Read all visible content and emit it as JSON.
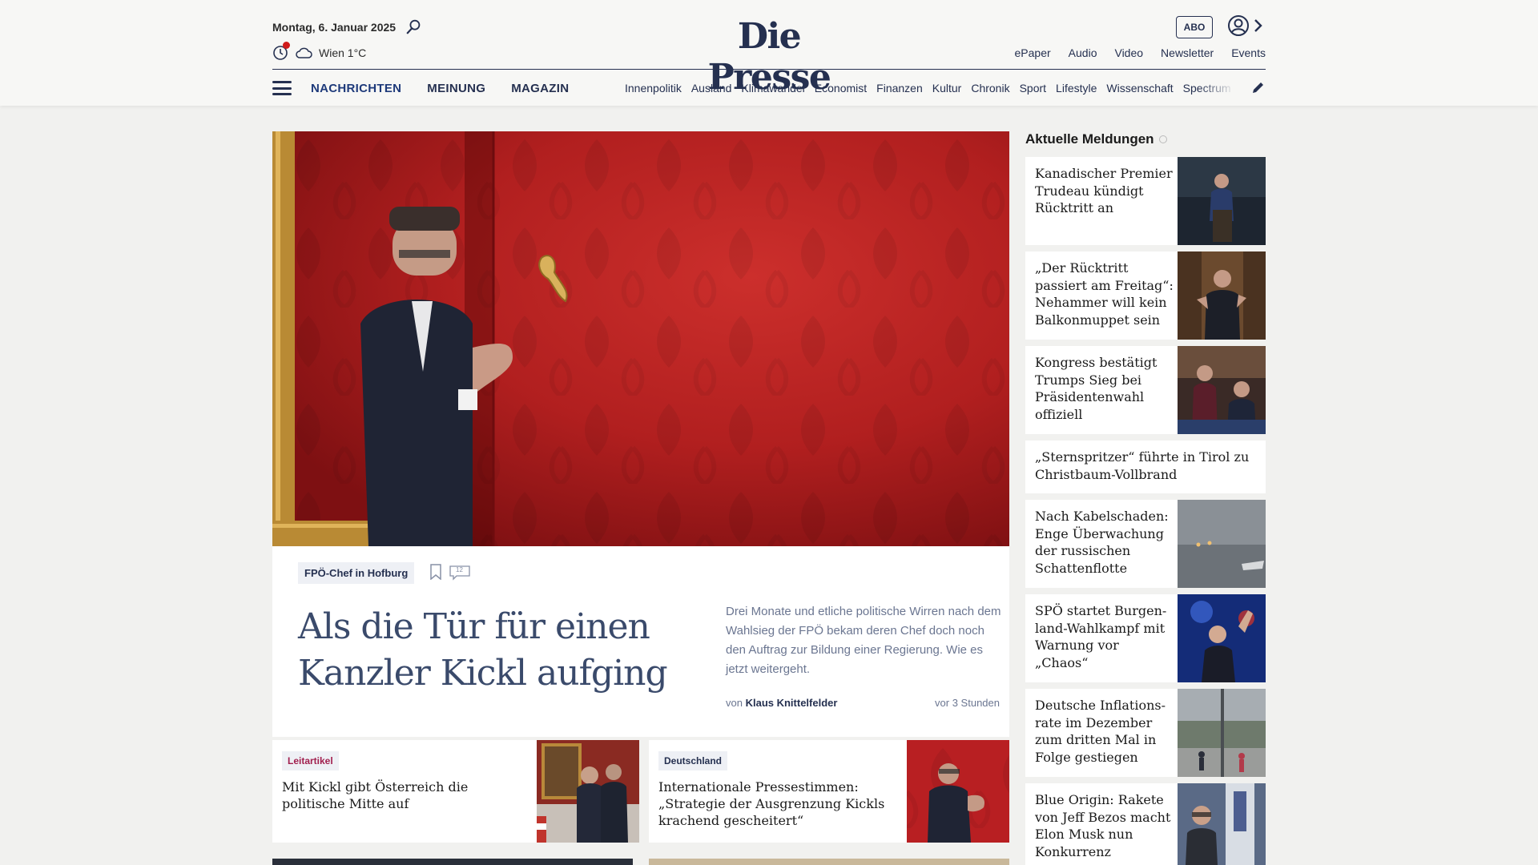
{
  "header": {
    "date": "Montag, 6. Januar 2025",
    "weather": "Wien 1°C",
    "logo": "Die Presse",
    "abo_label": "ABO",
    "top_links": [
      "ePaper",
      "Audio",
      "Video",
      "Newsletter",
      "Events"
    ]
  },
  "nav": {
    "main": [
      "NACHRICHTEN",
      "MEINUNG",
      "MAGAZIN"
    ],
    "sub": [
      "Innenpolitik",
      "Ausland",
      "Klimawandel",
      "Economist",
      "Finanzen",
      "Kultur",
      "Chronik",
      "Sport",
      "Lifestyle",
      "Wissenschaft",
      "Spectrum"
    ]
  },
  "hero": {
    "tag": "FPÖ-Chef in Hofburg",
    "comments": "12",
    "title": "Als die Tür für einen Kanzler Kickl aufging",
    "lead": "Drei Monate und etliche politische Wirren nach dem Wahlsieg der FPÖ bekam deren Chef doch noch den Auftrag zur Bildung einer Regierung. Wie es jetzt weitergeht.",
    "byline_prefix": "von",
    "author": "Klaus Knittelfelder",
    "time": "vor 3 Stunden"
  },
  "cards": [
    {
      "tag": "Leitartikel",
      "tag_color": "#a11f4e",
      "title": "Mit Kickl gibt Österreich die politische Mitte auf"
    },
    {
      "tag": "Deutschland",
      "tag_color": "#253050",
      "title": "Internationale Pressestimmen: „Strategie der Ausgrenzung Kickls krachend gescheitert“"
    }
  ],
  "sidebar": {
    "heading": "Aktuelle Meldungen",
    "items": [
      {
        "title": "Kanadischer Premier Trudeau kündigt Rücktritt an"
      },
      {
        "title": "„Der Rücktritt passiert am Freitag“: Nehammer will kein Balkonmuppet sein"
      },
      {
        "title": "Kongress bestätigt Trumps Sieg bei Präsidentenwahl offiziell"
      },
      {
        "title": "„Sternspritzer“ führte in Tirol zu Christbaum-Vollbrand"
      },
      {
        "title": "Nach Kabelschaden: Enge Überwachung der russischen Schattenflotte"
      },
      {
        "title": "SPÖ startet Burgen-land-Wahlkampf mit Warnung vor „Chaos“"
      },
      {
        "title": "Deutsche Inflations-rate im Dezember zum dritten Mal in Folge gestiegen"
      },
      {
        "title": "Blue Origin: Rakete von Jeff Bezos macht Elon Musk nun Konkurrenz"
      }
    ]
  },
  "colors": {
    "brand": "#253050",
    "accent_red": "#d01b1b"
  }
}
